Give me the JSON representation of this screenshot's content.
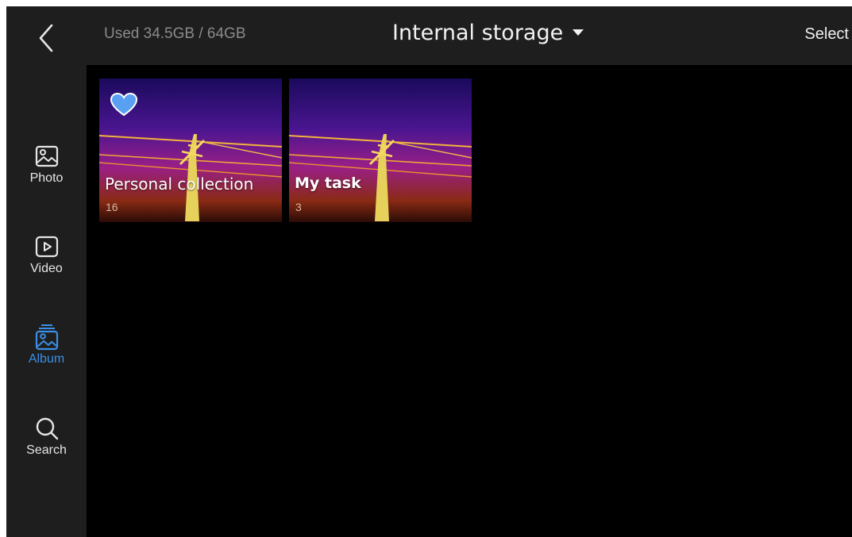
{
  "header": {
    "storage_used": "Used 34.5GB / 64GB",
    "title": "Internal storage",
    "select_label": "Select"
  },
  "nav": {
    "items": [
      {
        "label": "Photo",
        "icon": "photo-icon",
        "active": false
      },
      {
        "label": "Video",
        "icon": "video-icon",
        "active": false
      },
      {
        "label": "Album",
        "icon": "album-icon",
        "active": true
      },
      {
        "label": "Search",
        "icon": "search-icon",
        "active": false
      }
    ]
  },
  "albums": [
    {
      "name": "Personal collection",
      "count": "16",
      "favorite": true
    },
    {
      "name": "My task",
      "count": "3",
      "favorite": false
    }
  ],
  "colors": {
    "accent": "#3b8fe6",
    "rail_bg": "#1e1e1e",
    "content_bg": "#000000",
    "favorite": "#5aa0f2"
  }
}
